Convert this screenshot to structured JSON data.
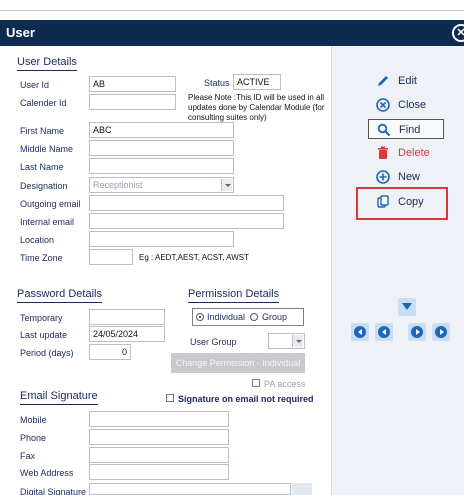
{
  "window": {
    "title": "User",
    "close_icon": "close-circle-icon"
  },
  "user_details": {
    "section_title": "User Details",
    "user_id_label": "User Id",
    "user_id": "AB",
    "calender_id_label": "Calender Id",
    "calender_id": "",
    "status_label": "Status",
    "status": "ACTIVE",
    "note": "Please Note :This ID will be used in all updates done by Calendar Module (for consulting suites only)",
    "first_name_label": "First Name",
    "first_name": "ABC",
    "middle_name_label": "Middle Name",
    "middle_name": "",
    "last_name_label": "Last Name",
    "last_name": "",
    "designation_label": "Designation",
    "designation": "Receptionist",
    "outgoing_email_label": "Outgoing email",
    "outgoing_email": "",
    "internal_email_label": "Internal email",
    "internal_email": "",
    "location_label": "Location",
    "location": "",
    "time_zone_label": "Time Zone",
    "time_zone": "",
    "time_zone_hint": "Eg : AEDT,AEST, ACST, AWST"
  },
  "password_details": {
    "section_title": "Password Details",
    "temporary_label": "Temporary",
    "temporary": "",
    "last_update_label": "Last update",
    "last_update": "24/05/2024",
    "period_label": "Period (days)",
    "period": "0"
  },
  "permission_details": {
    "section_title": "Permission Details",
    "individual_label": "Individual",
    "group_label": "Group",
    "selected": "Individual",
    "user_group_label": "User Group",
    "user_group": "",
    "change_button": "Change Permission - Individual",
    "pa_access_label": "PA access"
  },
  "email_signature": {
    "section_title": "Email Signature",
    "not_required_label": "Signature on email not required",
    "mobile_label": "Mobile",
    "mobile": "",
    "phone_label": "Phone",
    "phone": "",
    "fax_label": "Fax",
    "fax": "",
    "web_label": "Web Address",
    "web": "",
    "digital_label": "Digital Signature",
    "digital": ""
  },
  "actions": {
    "edit": "Edit",
    "close": "Close",
    "find": "Find",
    "delete": "Delete",
    "new": "New",
    "copy": "Copy"
  },
  "colors": {
    "title_bar": "#0d2a4f",
    "accent_blue": "#1e66b8",
    "delete_red": "#d53a3a",
    "highlight": "#d53a3a"
  }
}
